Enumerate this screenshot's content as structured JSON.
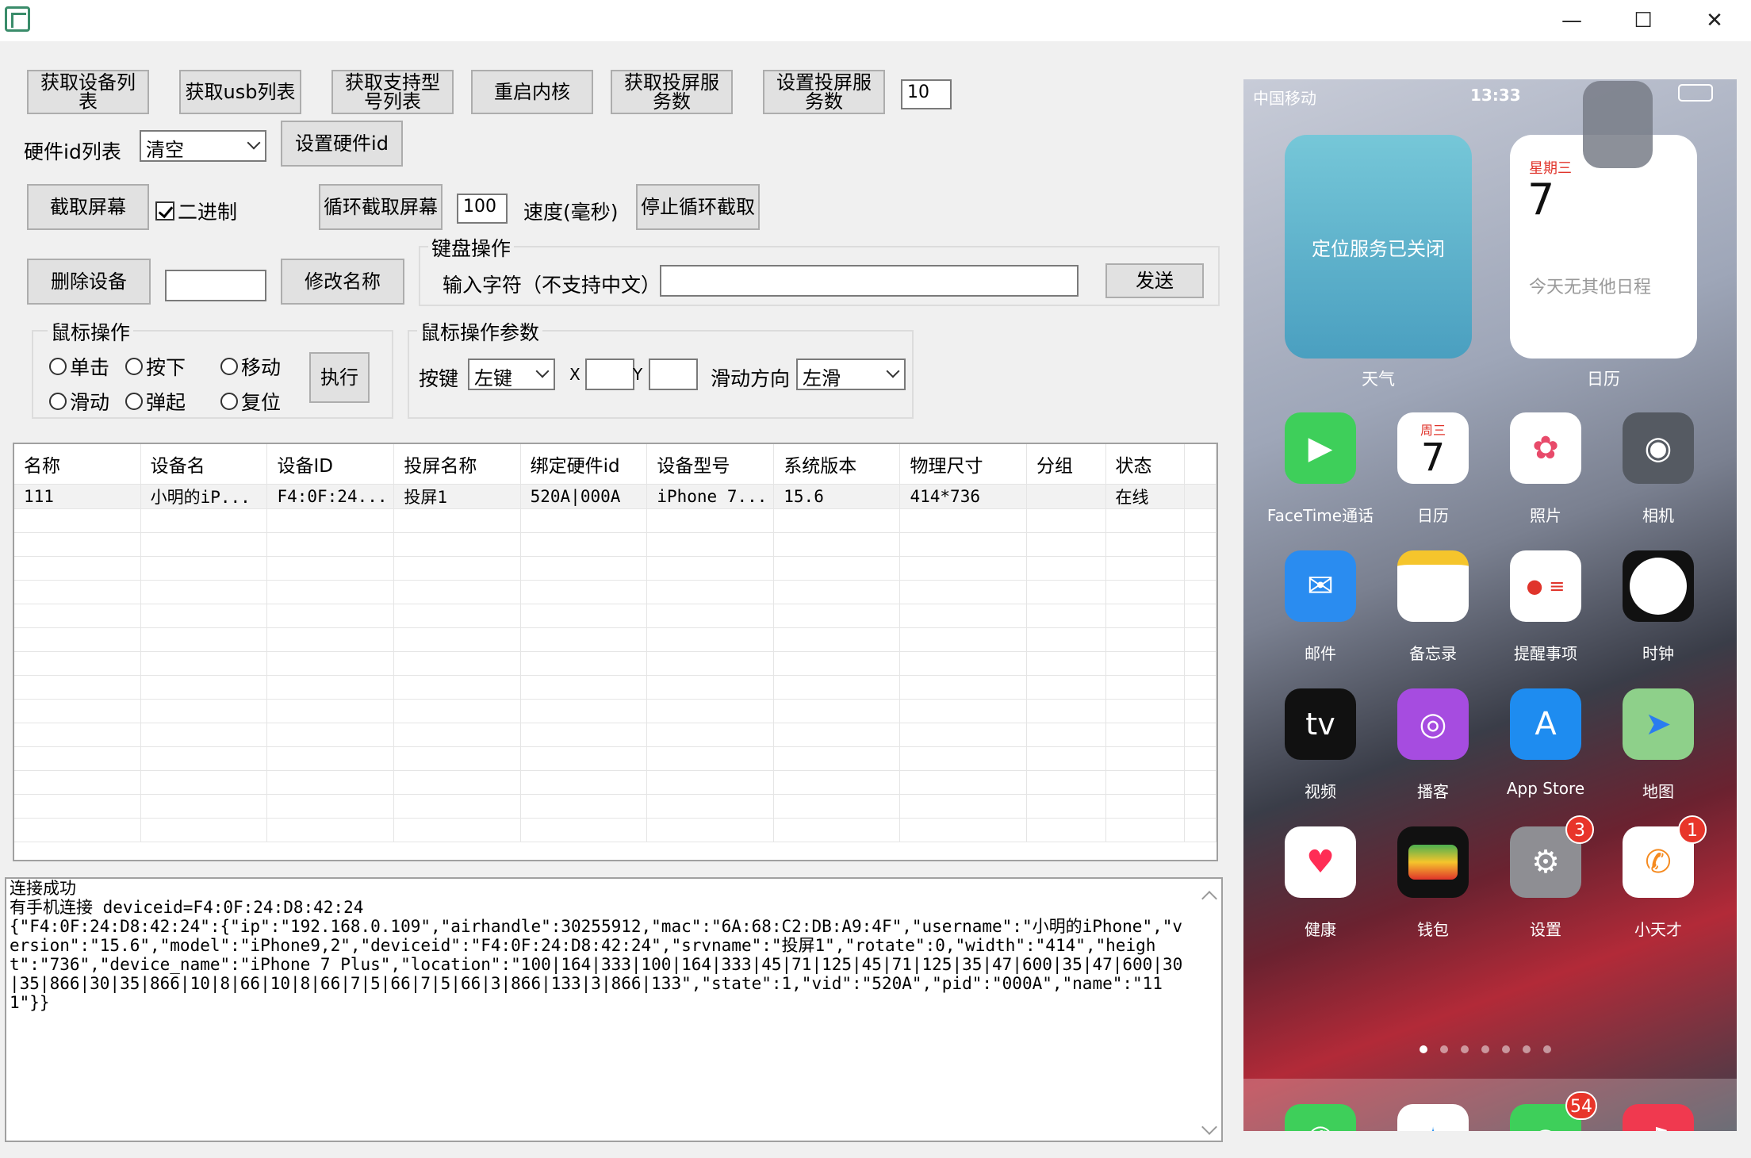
{
  "window": {
    "minimize": "—",
    "maximize": "☐",
    "close": "✕"
  },
  "toolbar": {
    "get_device_list": "获取设备列表",
    "get_usb_list": "获取usb列表",
    "get_supported_models": "获取支持型号列表",
    "restart_kernel": "重启内核",
    "get_cast_service_count": "获取投屏服务数",
    "set_cast_service_count": "设置投屏服务数",
    "cast_service_value": "10"
  },
  "hardware": {
    "label": "硬件id列表",
    "selected": "清空",
    "set_button": "设置硬件id"
  },
  "capture": {
    "screenshot_button": "截取屏幕",
    "binary_label": "二进制",
    "loop_button": "循环截取屏幕",
    "speed_value": "100",
    "speed_label": "速度(毫秒)",
    "stop_button": "停止循环截取"
  },
  "device": {
    "delete_button": "删除设备",
    "name_value": "",
    "rename_button": "修改名称"
  },
  "keyboard": {
    "title": "键盘操作",
    "input_label": "输入字符（不支持中文）",
    "input_value": "",
    "send_button": "发送"
  },
  "mouse": {
    "title": "鼠标操作",
    "options": [
      "单击",
      "按下",
      "移动",
      "滑动",
      "弹起",
      "复位"
    ],
    "execute_button": "执行"
  },
  "mouse_params": {
    "title": "鼠标操作参数",
    "key_label": "按键",
    "key_selected": "左键",
    "x_label": "X",
    "x_value": "",
    "y_label": "Y",
    "y_value": "",
    "direction_label": "滑动方向",
    "direction_selected": "左滑"
  },
  "table": {
    "columns": [
      "名称",
      "设备名",
      "设备ID",
      "投屏名称",
      "绑定硬件id",
      "设备型号",
      "系统版本",
      "物理尺寸",
      "分组",
      "状态"
    ],
    "rows": [
      [
        "111",
        "小明的iP...",
        "F4:0F:24...",
        "投屏1",
        "520A|000A",
        "iPhone 7...",
        "15.6",
        "414*736",
        "",
        "在线"
      ]
    ]
  },
  "log": {
    "text": "连接成功\n有手机连接 deviceid=F4:0F:24:D8:42:24\n{\"F4:0F:24:D8:42:24\":{\"ip\":\"192.168.0.109\",\"airhandle\":30255912,\"mac\":\"6A:68:C2:DB:A9:4F\",\"username\":\"小明的iPhone\",\"version\":\"15.6\",\"model\":\"iPhone9,2\",\"deviceid\":\"F4:0F:24:D8:42:24\",\"srvname\":\"投屏1\",\"rotate\":0,\"width\":\"414\",\"height\":\"736\",\"device_name\":\"iPhone 7 Plus\",\"location\":\"100|164|333|100|164|333|45|71|125|45|71|125|35|47|600|35|47|600|30|35|866|30|35|866|10|8|66|10|8|66|7|5|66|7|5|66|3|866|133|3|866|133\",\"state\":1,\"vid\":\"520A\",\"pid\":\"000A\",\"name\":\"111\"}}"
  },
  "phone": {
    "carrier": "中国移动",
    "time": "13:33",
    "weather_widget_text": "定位服务已关闭",
    "weather_label": "天气",
    "calendar_weekday": "星期三",
    "calendar_day": "7",
    "calendar_note": "今天无其他日程",
    "calendar_label": "日历",
    "apps": [
      {
        "label": "FaceTime通话",
        "icon": "video-icon",
        "color": "#3ecf5a"
      },
      {
        "label": "日历",
        "icon": "calendar-icon",
        "color": "#ffffff"
      },
      {
        "label": "照片",
        "icon": "photos-icon",
        "color": "#ffffff"
      },
      {
        "label": "相机",
        "icon": "camera-icon",
        "color": "#555a62"
      },
      {
        "label": "邮件",
        "icon": "mail-icon",
        "color": "#2a8cf0"
      },
      {
        "label": "备忘录",
        "icon": "notes-icon",
        "color": "#ffffff"
      },
      {
        "label": "提醒事项",
        "icon": "reminders-icon",
        "color": "#ffffff"
      },
      {
        "label": "时钟",
        "icon": "clock-icon",
        "color": "#111111"
      },
      {
        "label": "视频",
        "icon": "tv-icon",
        "color": "#111111"
      },
      {
        "label": "播客",
        "icon": "podcast-icon",
        "color": "#a64ce0"
      },
      {
        "label": "App Store",
        "icon": "appstore-icon",
        "color": "#1e8cf0"
      },
      {
        "label": "地图",
        "icon": "maps-icon",
        "color": "#8ed08a"
      },
      {
        "label": "健康",
        "icon": "heart-icon",
        "color": "#ffffff"
      },
      {
        "label": "钱包",
        "icon": "wallet-icon",
        "color": "#111111"
      },
      {
        "label": "设置",
        "icon": "gear-icon",
        "color": "#8e8e93"
      },
      {
        "label": "小天才",
        "icon": "xtc-icon",
        "color": "#ffffff"
      }
    ],
    "app_calendar_weekday": "周三",
    "app_calendar_day": "7",
    "tv_text": "tv",
    "settings_badge": "3",
    "xtc_badge": "1",
    "messages_badge": "54",
    "dock": [
      "phone-icon",
      "safari-icon",
      "messages-icon",
      "music-icon"
    ]
  }
}
